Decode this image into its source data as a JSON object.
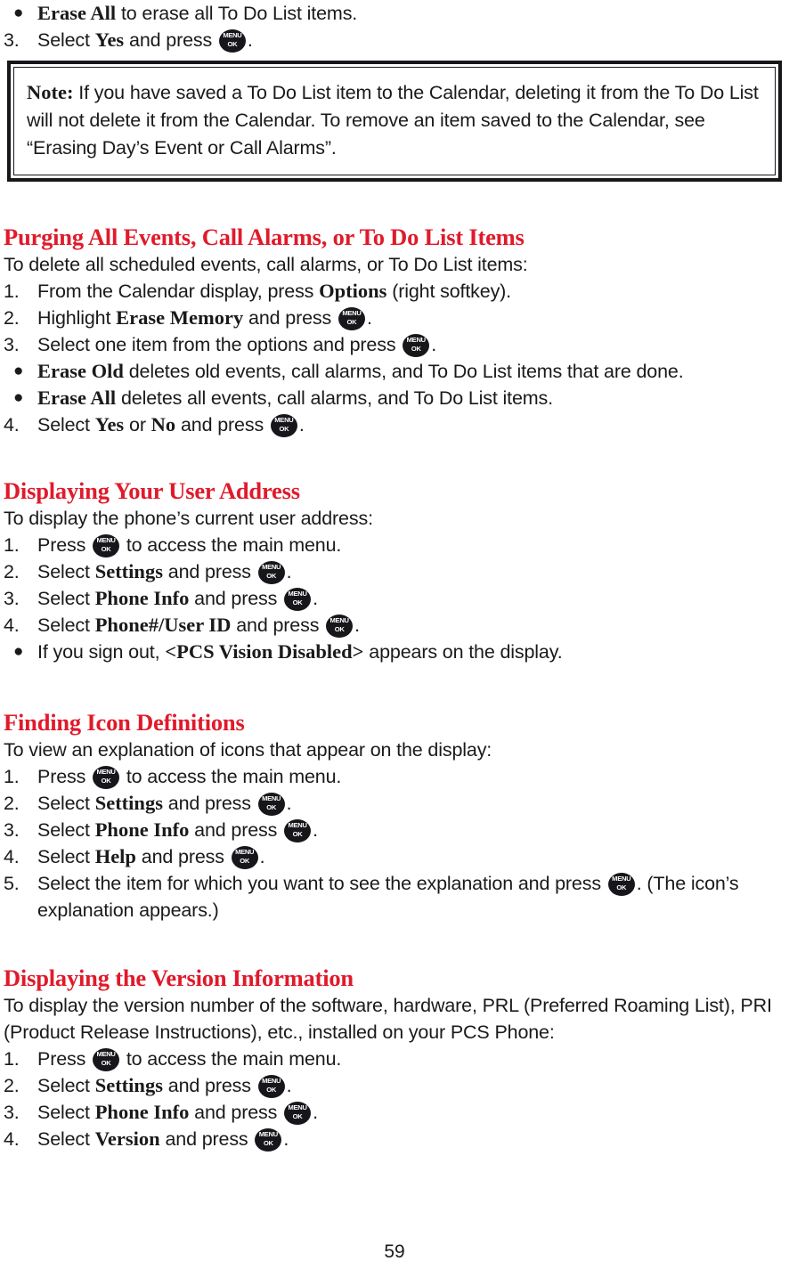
{
  "page": {
    "number": "59",
    "heading_color": "#e01a2b",
    "key_icon": {
      "name": "menu-ok-key",
      "line1": "MENU",
      "line2": "OK"
    }
  },
  "top_items": {
    "bullet_marker": "●",
    "erase_all_bullet": {
      "term": "Erase All",
      "rest": " to erase all To Do List items."
    },
    "step3": {
      "marker": "3.",
      "before": "Select ",
      "term": "Yes",
      "after": " and press ",
      "tail": "."
    }
  },
  "note_box": {
    "label": "Note:",
    "text": " If you have saved a To Do List item to the Calendar, deleting it from the To Do List will not delete it from the Calendar. To remove an item saved to the Calendar, see “Erasing Day’s Event or Call Alarms”."
  },
  "sections": [
    {
      "id": "purging",
      "heading": "Purging All Events, Call Alarms, or To Do List Items",
      "intro": "To delete all scheduled events, call alarms, or To Do List items:",
      "steps": [
        {
          "marker": "1.",
          "before": "From the Calendar display, press ",
          "term": "Options",
          "after": " (right softkey).",
          "key": false
        },
        {
          "marker": "2.",
          "before": "Highlight ",
          "term": "Erase Memory",
          "after": " and press ",
          "tail": ".",
          "key": true
        },
        {
          "marker": "3.",
          "before": "Select one item from the options and press ",
          "term": "",
          "after": "",
          "tail": ".",
          "key": true
        },
        {
          "marker": "●",
          "bullet": true,
          "before": "",
          "term": "Erase Old",
          "after": " deletes old events, call alarms, and To Do List items that are done.",
          "key": false
        },
        {
          "marker": "●",
          "bullet": true,
          "before": "",
          "term": "Erase All",
          "after": " deletes all events, call alarms, and To Do List items.",
          "key": false
        },
        {
          "marker": "4.",
          "before": "Select ",
          "term": "Yes",
          "mid": " or ",
          "term2": "No",
          "after": " and press ",
          "tail": ".",
          "key": true
        }
      ]
    },
    {
      "id": "user-address",
      "heading": "Displaying Your User Address",
      "intro": "To display the phone’s current user address:",
      "steps": [
        {
          "marker": "1.",
          "before": "Press ",
          "after": " to access the main menu.",
          "key": true,
          "key_mid": true
        },
        {
          "marker": "2.",
          "before": "Select ",
          "term": "Settings",
          "after": " and press ",
          "tail": ".",
          "key": true
        },
        {
          "marker": "3.",
          "before": "Select ",
          "term": "Phone Info",
          "after": " and press ",
          "tail": ".",
          "key": true
        },
        {
          "marker": "4.",
          "before": "Select ",
          "term": "Phone#/User ID",
          "after": " and press ",
          "tail": ".",
          "key": true
        },
        {
          "marker": "●",
          "bullet": true,
          "before": "If you sign out, ",
          "term": "<PCS Vision Disabled>",
          "after": " appears on the display.",
          "key": false
        }
      ]
    },
    {
      "id": "icon-definitions",
      "heading": "Finding Icon Definitions",
      "intro": "To view an explanation of icons that appear on the display:",
      "steps": [
        {
          "marker": "1.",
          "before": "Press ",
          "after": " to access the main menu.",
          "key": true,
          "key_mid": true
        },
        {
          "marker": "2.",
          "before": "Select ",
          "term": "Settings",
          "after": " and press ",
          "tail": ".",
          "key": true
        },
        {
          "marker": "3.",
          "before": "Select ",
          "term": "Phone Info",
          "after": " and press ",
          "tail": ".",
          "key": true
        },
        {
          "marker": "4.",
          "before": "Select ",
          "term": "Help",
          "after": " and press ",
          "tail": ".",
          "key": true
        },
        {
          "marker": "5.",
          "before": "Select the item for which you want to see the explanation and press ",
          "after": "",
          "tail": ".  (The icon’s explanation appears.)",
          "key": true
        }
      ]
    },
    {
      "id": "version-info",
      "heading": "Displaying the Version Information",
      "intro": "To display the version number of the software, hardware, PRL (Preferred Roaming List), PRI (Product Release Instructions), etc., installed on your PCS Phone:",
      "steps": [
        {
          "marker": "1.",
          "before": "Press ",
          "after": " to access the main menu.",
          "key": true,
          "key_mid": true
        },
        {
          "marker": "2.",
          "before": "Select ",
          "term": "Settings",
          "after": " and press ",
          "tail": ".",
          "key": true
        },
        {
          "marker": "3.",
          "before": "Select ",
          "term": "Phone Info",
          "after": " and press ",
          "tail": ".",
          "key": true
        },
        {
          "marker": "4.",
          "before": "Select ",
          "term": "Version",
          "after": " and press ",
          "tail": ".",
          "key": true
        }
      ]
    }
  ]
}
